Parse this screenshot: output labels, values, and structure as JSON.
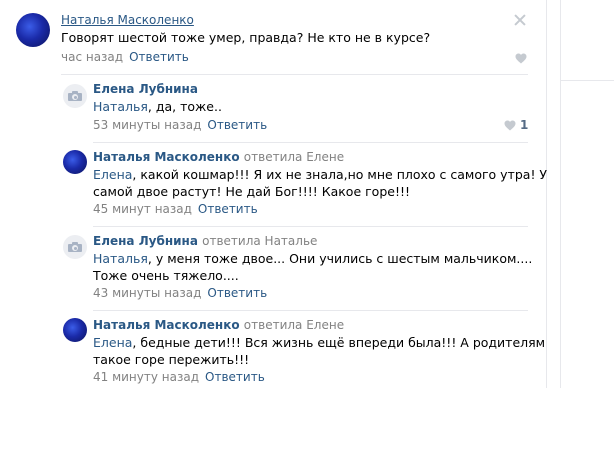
{
  "comments": [
    {
      "author": "Наталья Масколенко",
      "text": "Говорят шестой тоже умер, правда? Не кто не в курсе?",
      "time": "час назад",
      "reply_label": "Ответить"
    },
    {
      "author": "Елена Лубнина",
      "mention": "Наталья",
      "text": ", да, тоже..",
      "time": "53 минуты назад",
      "reply_label": "Ответить",
      "likes": "1"
    },
    {
      "author": "Наталья Масколенко",
      "reply_to": "ответила Елене",
      "mention": "Елена",
      "line1": ", какой кошмар!!! Я их не знала,но мне плохо с самого утра! У",
      "line2": "самой двое растут! Не дай Бог!!!! Какое горе!!!",
      "time": "45 минут назад",
      "reply_label": "Ответить"
    },
    {
      "author": "Елена Лубнина",
      "reply_to": "ответила Наталье",
      "mention": "Наталья",
      "line1": ", у меня тоже двое... Они учились с шестым мальчиком....",
      "line2": "Тоже очень тяжело....",
      "time": "43 минуты назад",
      "reply_label": "Ответить"
    },
    {
      "author": "Наталья Масколенко",
      "reply_to": "ответила Елене",
      "mention": "Елена",
      "line1": ", бедные дети!!! Вся жизнь ещё впереди была!!! А родителям",
      "line2": "такое горе пережить!!!",
      "time": "41 минуту назад",
      "reply_label": "Ответить"
    }
  ],
  "colors": {
    "link": "#2a5885",
    "meta": "#828282",
    "border": "#e7e8ec"
  },
  "icons": {
    "close": "close-icon",
    "like": "heart-icon",
    "camera": "camera-icon"
  }
}
